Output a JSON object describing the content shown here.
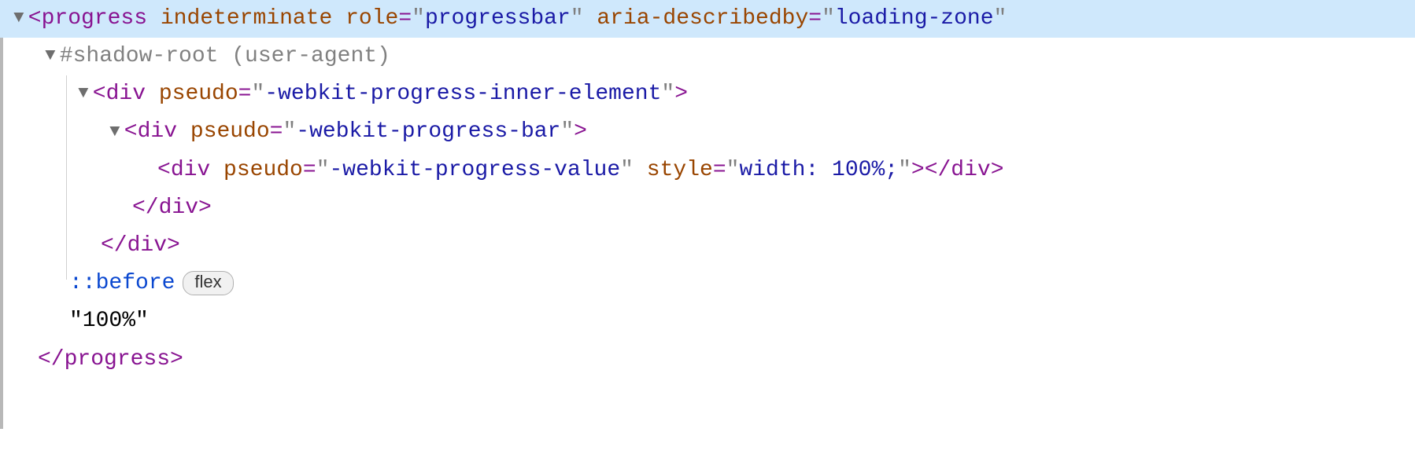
{
  "lines": {
    "l0": {
      "indent": 14,
      "arrow": "▼",
      "tag_open": "<",
      "tag_name": "progress",
      "attrs": [
        {
          "name": "indeterminate",
          "bare": true
        },
        {
          "name": "role",
          "val": "progressbar"
        },
        {
          "name": "aria-describedby",
          "val": "loading-zone"
        }
      ],
      "trailing_quote": "\""
    },
    "l1": {
      "indent": 54,
      "arrow": "▼",
      "text": "#shadow-root (user-agent)"
    },
    "l2": {
      "indent": 96,
      "arrow": "▼",
      "tag_name": "div",
      "attrs": [
        {
          "name": "pseudo",
          "val": "-webkit-progress-inner-element"
        }
      ],
      "tag_close": ">"
    },
    "l3": {
      "indent": 136,
      "arrow": "▼",
      "tag_name": "div",
      "attrs": [
        {
          "name": "pseudo",
          "val": "-webkit-progress-bar"
        }
      ],
      "tag_close": ">"
    },
    "l4": {
      "indent": 200,
      "tag_name": "div",
      "attrs": [
        {
          "name": "pseudo",
          "val": "-webkit-progress-value"
        },
        {
          "name": "style",
          "val": "width: 100%;"
        }
      ],
      "tag_close": ">",
      "end_tag": "</div>"
    },
    "l5": {
      "indent": 168,
      "end_tag": "</div>"
    },
    "l6": {
      "indent": 128,
      "end_tag": "</div>"
    },
    "l7": {
      "indent": 88,
      "pseudo": "::before",
      "badge": "flex"
    },
    "l8": {
      "indent": 88,
      "text_node": "\"100%\""
    },
    "l9": {
      "indent": 48,
      "end_tag": "</progress>"
    }
  }
}
